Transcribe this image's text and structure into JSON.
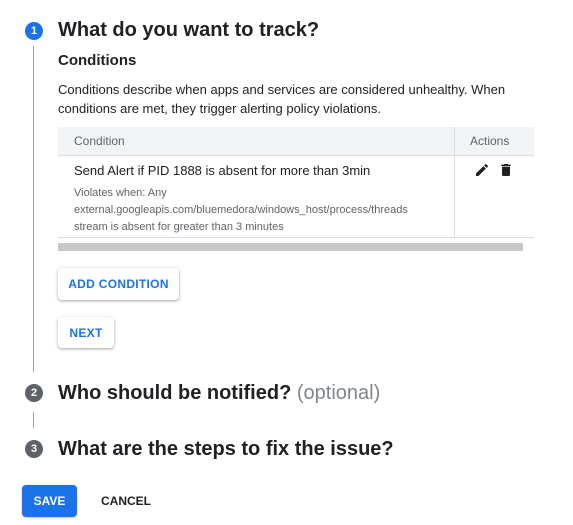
{
  "steps": [
    {
      "number": "1",
      "title": "What do you want to track?"
    },
    {
      "number": "2",
      "title": "Who should be notified?",
      "optional": "(optional)"
    },
    {
      "number": "3",
      "title": "What are the steps to fix the issue?"
    }
  ],
  "conditions": {
    "heading": "Conditions",
    "description": "Conditions describe when apps and services are considered unhealthy. When conditions are met, they trigger alerting policy violations.",
    "table": {
      "columns": [
        "Condition",
        "Actions"
      ],
      "rows": [
        {
          "title": "Send Alert if PID 1888 is absent for more than 3min",
          "detail_lines": [
            "Violates when: Any",
            "external.googleapis.com/bluemedora/windows_host/process/threads",
            "stream is absent for greater than 3 minutes"
          ],
          "actions": [
            "edit-icon",
            "delete-icon"
          ]
        }
      ]
    },
    "add_button": "ADD CONDITION",
    "next_button": "NEXT"
  },
  "footer": {
    "save": "SAVE",
    "cancel": "CANCEL"
  },
  "colors": {
    "accent": "#1a73e8",
    "inactive_badge": "#5f6368"
  }
}
